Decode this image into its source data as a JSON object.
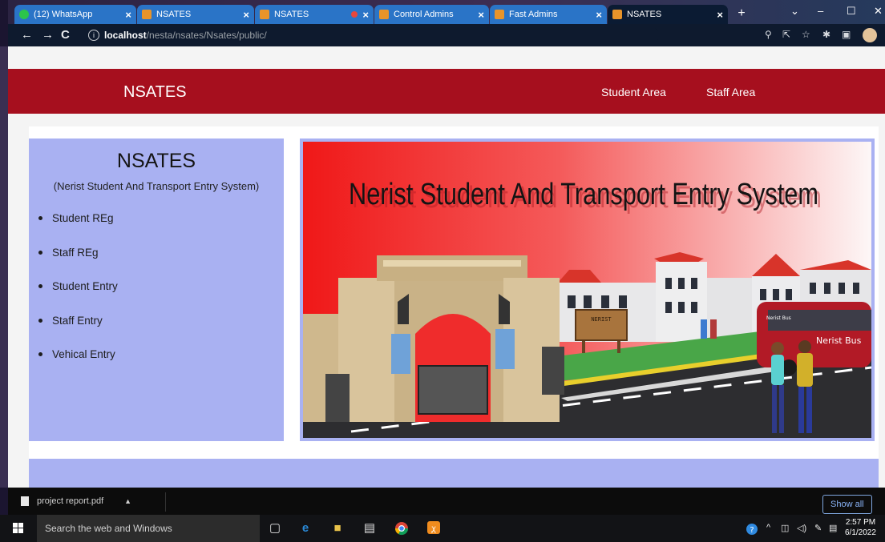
{
  "browser": {
    "tabs": [
      {
        "title": "(12) WhatsApp",
        "icon": "whatsapp-icon"
      },
      {
        "title": "NSATES",
        "icon": "app-icon"
      },
      {
        "title": "NSATES",
        "icon": "app-icon"
      },
      {
        "title": "",
        "icon": "recording-icon"
      },
      {
        "title": "Control Admins",
        "icon": "app-icon"
      },
      {
        "title": "Fast Admins",
        "icon": "app-icon"
      },
      {
        "title": "NSATES",
        "icon": "app-icon",
        "active": true
      }
    ],
    "tab_close": "×",
    "new_tab": "+",
    "url_host": "localhost",
    "url_path": "/nesta/nsates/Nsates/public/"
  },
  "navbar": {
    "brand": "NSATES",
    "links": [
      "Student Area",
      "Staff Area"
    ],
    "color": "#a60f1e"
  },
  "sidebar": {
    "title": "NSATES",
    "subtitle": "(Nerist Student And Transport Entry System)",
    "items": [
      "Student REg",
      "Staff REg",
      "Student Entry",
      "Staff Entry",
      "Vehical Entry"
    ],
    "color": "#a9b1f2"
  },
  "banner": {
    "headline": "Nerist Student And Transport Entry System",
    "sign_text": "NERIST",
    "bus_label": "Nerist Bus",
    "bus_small_label": "Nerist Bus"
  },
  "downloads": {
    "file": "project report.pdf",
    "show_all": "Show all"
  },
  "taskbar": {
    "search_placeholder": "Search the web and Windows",
    "time": "2:57 PM",
    "date": "6/1/2022"
  }
}
